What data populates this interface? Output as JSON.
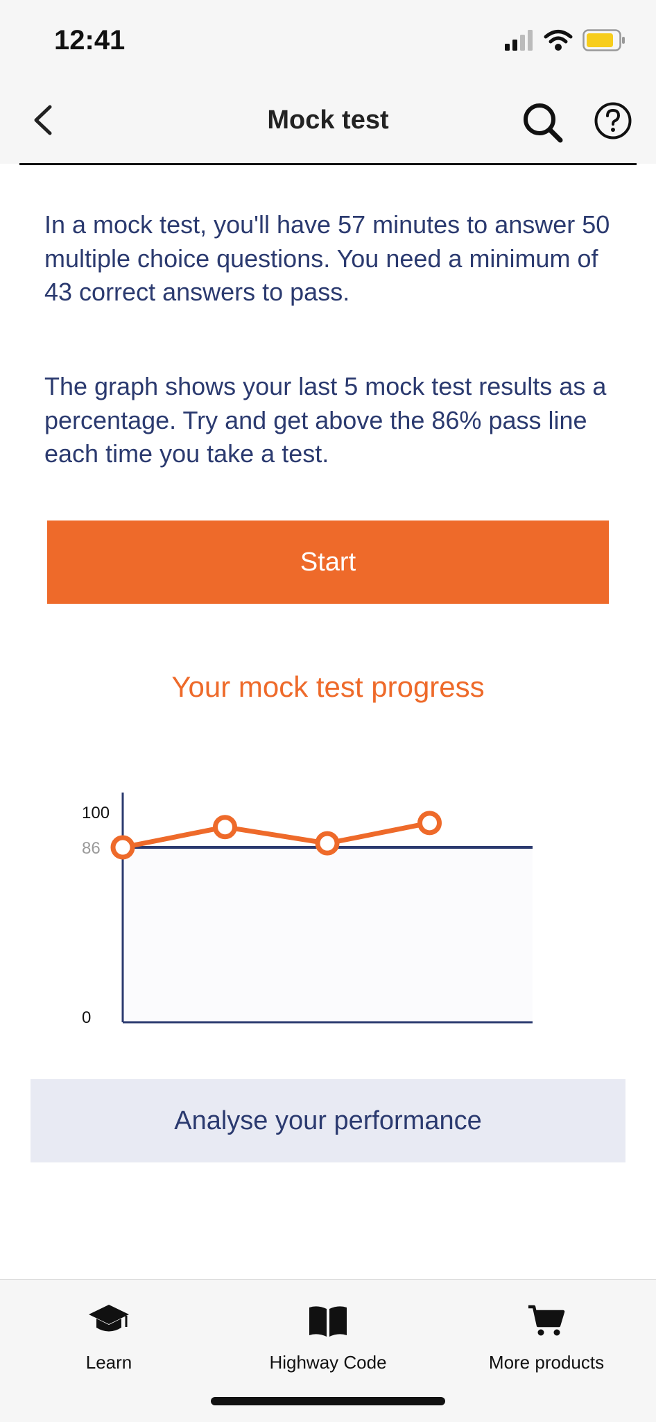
{
  "status_bar": {
    "time": "12:41",
    "icons": [
      "signal-icon",
      "wifi-icon",
      "battery-icon"
    ]
  },
  "header": {
    "title": "Mock test",
    "icons": [
      "back-icon",
      "search-icon",
      "help-icon"
    ]
  },
  "intro": {
    "paragraph1": "In a mock test, you'll have 57 minutes to answer 50 multiple choice questions. You need a minimum of 43 correct answers to pass.",
    "paragraph2": "The graph shows your last 5 mock test results as a percentage. Try and get above the 86% pass line each time you take a test."
  },
  "start_button": {
    "label": "Start"
  },
  "progress": {
    "title": "Your mock test progress"
  },
  "chart_data": {
    "type": "line",
    "title": "Your mock test progress",
    "x": [
      1,
      2,
      3,
      4
    ],
    "series": [
      {
        "values": [
          86,
          96,
          88,
          98
        ]
      }
    ],
    "pass_line": 86,
    "ylim": [
      0,
      100
    ],
    "yticks": [
      "100",
      "86",
      "0"
    ],
    "grid": false
  },
  "analyse_button": {
    "label": "Analyse your performance"
  },
  "tab_bar": {
    "learn": {
      "label": "Learn",
      "icon": "graduation-cap-icon"
    },
    "highway_code": {
      "label": "Highway Code",
      "icon": "book-icon"
    },
    "more_products": {
      "label": "More products",
      "icon": "cart-icon"
    }
  },
  "colors": {
    "accent": "#ee6a2a",
    "navy": "#2b3a6f",
    "panel": "#e8eaf3"
  }
}
